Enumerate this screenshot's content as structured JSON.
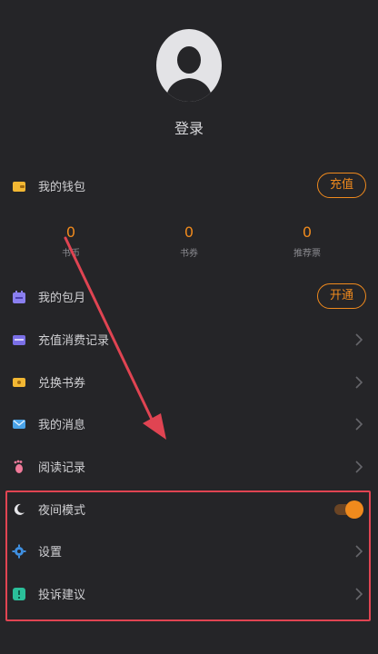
{
  "profile": {
    "login_label": "登录",
    "avatar_icon": "user-avatar-icon"
  },
  "wallet": {
    "label": "我的钱包",
    "icon": "wallet-icon",
    "button_label": "充值"
  },
  "stats": [
    {
      "value": "0",
      "label": "书币"
    },
    {
      "value": "0",
      "label": "书券"
    },
    {
      "value": "0",
      "label": "推荐票"
    }
  ],
  "menu": [
    {
      "label": "我的包月",
      "icon": "calendar-icon",
      "button_label": "开通"
    },
    {
      "label": "充值消费记录",
      "icon": "card-icon"
    },
    {
      "label": "兑换书券",
      "icon": "ticket-icon"
    },
    {
      "label": "我的消息",
      "icon": "mail-icon"
    },
    {
      "label": "阅读记录",
      "icon": "footprint-icon"
    },
    {
      "label": "夜间模式",
      "icon": "moon-icon",
      "toggle_on": true
    },
    {
      "label": "设置",
      "icon": "gear-icon"
    },
    {
      "label": "投诉建议",
      "icon": "feedback-icon"
    }
  ],
  "colors": {
    "background": "#252528",
    "accent": "#f08a1d",
    "annotation": "#e04452"
  }
}
